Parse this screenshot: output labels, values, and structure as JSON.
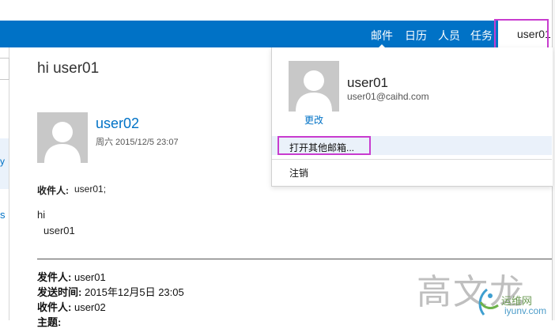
{
  "nav": {
    "items": [
      "邮件",
      "日历",
      "人员",
      "任务"
    ],
    "user": "user01"
  },
  "message": {
    "subject": "hi user01",
    "sender": "user02",
    "date": "周六 2015/12/5 23:07",
    "to_label": "收件人:",
    "to_value": "user01;",
    "body": [
      "hi",
      "user01"
    ],
    "quoted": [
      {
        "label": "发件人:",
        "value": "user01"
      },
      {
        "label": "发送时间:",
        "value": "2015年12月5日 23:05"
      },
      {
        "label": "收件人:",
        "value": "user02"
      },
      {
        "label": "主题:",
        "value": ""
      }
    ]
  },
  "account_menu": {
    "name": "user01",
    "email": "user01@caihd.com",
    "change": "更改",
    "open_other": "打开其他邮箱...",
    "sign_out": "注销"
  },
  "watermark": {
    "text": "高文龙",
    "site_cn": "运维网",
    "site_domain": "iyunv.com"
  },
  "colors": {
    "accent": "#0072c6",
    "highlight": "#c83ccf"
  }
}
